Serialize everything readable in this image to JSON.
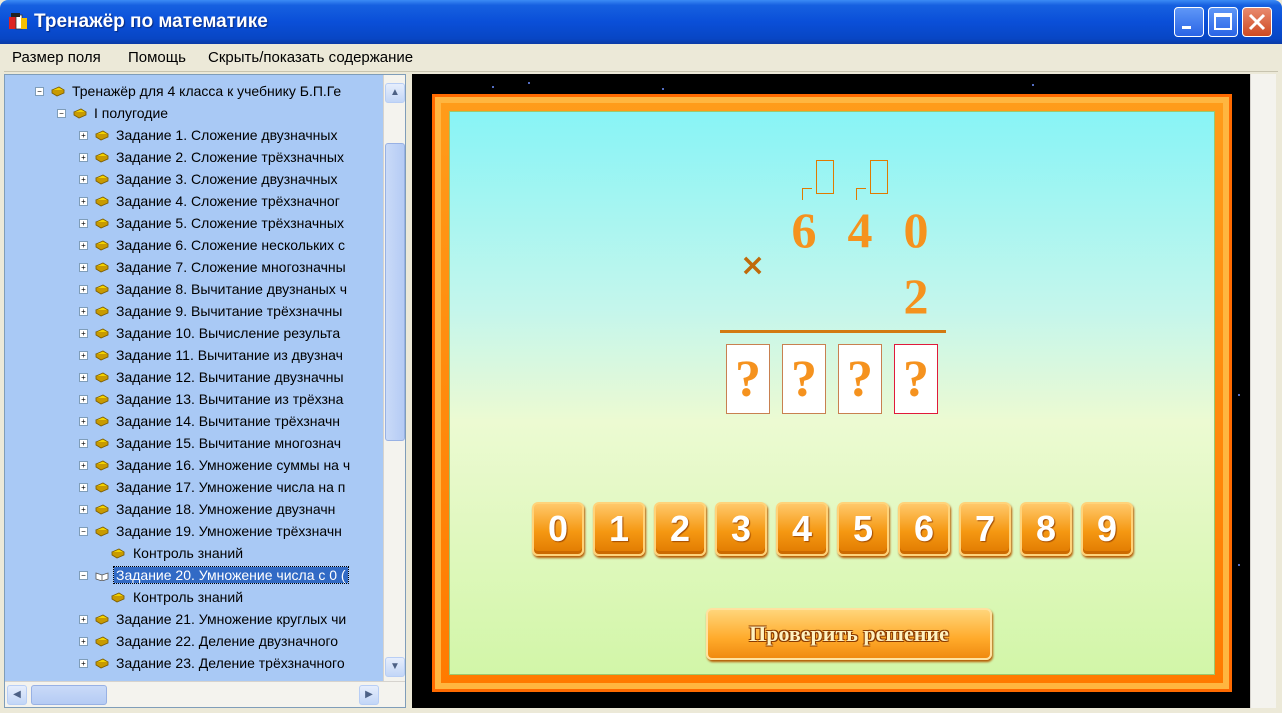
{
  "window": {
    "title": "Тренажёр по математике"
  },
  "menu": [
    {
      "label": "Размер поля"
    },
    {
      "label": "Помощь"
    },
    {
      "label": "Скрыть/показать содержание"
    }
  ],
  "tree": {
    "items": [
      {
        "label": "Тренажёр для 4 класса к учебнику Б.П.Ге",
        "level": 0,
        "expander": "−",
        "selected": false
      },
      {
        "label": "I полугодие",
        "level": 1,
        "expander": "−",
        "selected": false
      },
      {
        "label": "Задание 1. Сложение двузначных",
        "level": 2,
        "expander": "+",
        "selected": false
      },
      {
        "label": "Задание 2. Сложение трёхзначных",
        "level": 2,
        "expander": "+",
        "selected": false
      },
      {
        "label": "Задание 3. Сложение двузначных",
        "level": 2,
        "expander": "+",
        "selected": false
      },
      {
        "label": "Задание 4. Сложение трёхзначног",
        "level": 2,
        "expander": "+",
        "selected": false
      },
      {
        "label": "Задание 5. Сложение трёхзначных",
        "level": 2,
        "expander": "+",
        "selected": false
      },
      {
        "label": "Задание 6. Сложение нескольких с",
        "level": 2,
        "expander": "+",
        "selected": false
      },
      {
        "label": "Задание 7. Сложение многозначны",
        "level": 2,
        "expander": "+",
        "selected": false
      },
      {
        "label": "Задание 8. Вычитание двузнаных ч",
        "level": 2,
        "expander": "+",
        "selected": false
      },
      {
        "label": "Задание 9. Вычитание трёхзначны",
        "level": 2,
        "expander": "+",
        "selected": false
      },
      {
        "label": "Задание 10. Вычисление результа",
        "level": 2,
        "expander": "+",
        "selected": false
      },
      {
        "label": "Задание 11. Вычитание из двузнач",
        "level": 2,
        "expander": "+",
        "selected": false
      },
      {
        "label": "Задание 12. Вычитание двузначны",
        "level": 2,
        "expander": "+",
        "selected": false
      },
      {
        "label": "Задание 13. Вычитание из трёхзна",
        "level": 2,
        "expander": "+",
        "selected": false
      },
      {
        "label": "Задание 14. Вычитание трёхзначн",
        "level": 2,
        "expander": "+",
        "selected": false
      },
      {
        "label": "Задание 15. Вычитание многознач",
        "level": 2,
        "expander": "+",
        "selected": false
      },
      {
        "label": "Задание 16. Умножение суммы на ч",
        "level": 2,
        "expander": "+",
        "selected": false
      },
      {
        "label": "Задание 17. Умножение числа на п",
        "level": 2,
        "expander": "+",
        "selected": false
      },
      {
        "label": "Задание 18. Умножение двузначн",
        "level": 2,
        "expander": "+",
        "selected": false
      },
      {
        "label": "Задание 19. Умножение трёхзначн",
        "level": 2,
        "expander": "−",
        "selected": false
      },
      {
        "label": "Контроль знаний",
        "level": 3,
        "expander": "",
        "selected": false
      },
      {
        "label": "Задание 20. Умножение числа с 0 (",
        "level": 2,
        "expander": "−",
        "selected": true
      },
      {
        "label": "Контроль знаний",
        "level": 3,
        "expander": "",
        "selected": false
      },
      {
        "label": "Задание 21. Умножение круглых чи",
        "level": 2,
        "expander": "+",
        "selected": false
      },
      {
        "label": "Задание 22. Деление двузначного",
        "level": 2,
        "expander": "+",
        "selected": false
      },
      {
        "label": "Задание 23. Деление трёхзначного",
        "level": 2,
        "expander": "+",
        "selected": false
      }
    ]
  },
  "exercise": {
    "multiplicand": [
      "6",
      "4",
      "0"
    ],
    "multiplier": "2",
    "operator": "×",
    "answer": [
      "?",
      "?",
      "?",
      "?"
    ],
    "keys": [
      "0",
      "1",
      "2",
      "3",
      "4",
      "5",
      "6",
      "7",
      "8",
      "9"
    ],
    "check_label": "Проверить решение"
  }
}
